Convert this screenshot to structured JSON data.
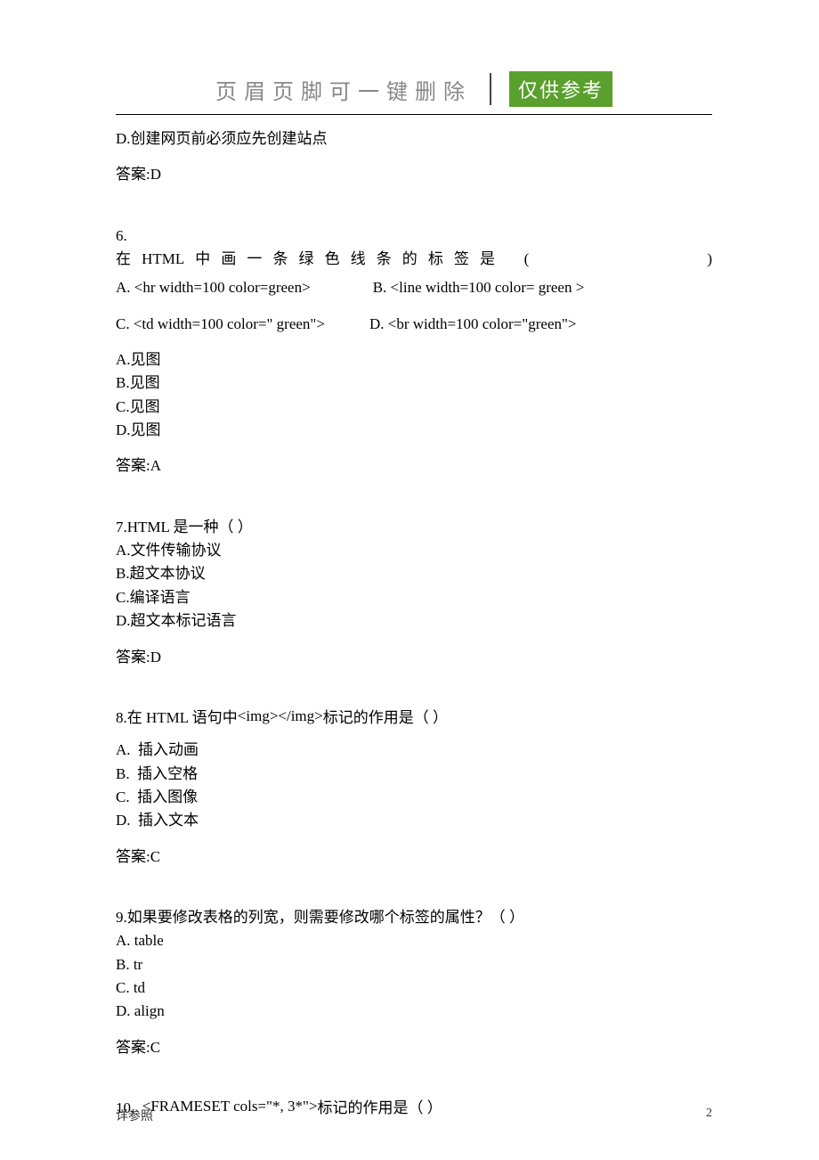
{
  "header": {
    "title": "页眉页脚可一键删除",
    "badge": "仅供参考"
  },
  "q5_tail": {
    "optD": "D.创建网页前必须应先创建站点",
    "answer": "答案:D"
  },
  "q6": {
    "num": "6.",
    "stem_chars": [
      "在",
      "HTML",
      "中",
      "画",
      "一",
      "条",
      "绿",
      "色",
      "线",
      "条",
      "的",
      "标",
      "签",
      "是"
    ],
    "paren_open": "(",
    "paren_close": ")",
    "imgA": "A. <hr width=100 color=green>",
    "imgB": "B. <line width=100 color= green >",
    "imgC": "C. <td width=100 color=\" green\">",
    "imgD": "D. <br width=100 color=\"green\">",
    "optA": "A.见图",
    "optB": "B.见图",
    "optC": "C.见图",
    "optD": "D.见图",
    "answer": "答案:A"
  },
  "q7": {
    "stem": "7.HTML 是一种（   ）",
    "optA": "A.文件传输协议",
    "optB": "B.超文本协议",
    "optC": "C.编译语言",
    "optD": "D.超文本标记语言",
    "answer": "答案:D"
  },
  "q8": {
    "stem_pre": "8.在 HTML 语句中",
    "img_tag": "<img></img>",
    "stem_post": "标记的作用是（          ）",
    "optA": "A.  插入动画",
    "optB": "B.  插入空格",
    "optC": "C.  插入图像",
    "optD": "D.  插入文本",
    "answer": "答案:C"
  },
  "q9": {
    "stem": "9.如果要修改表格的列宽，则需要修改哪个标签的属性？（      ）",
    "optA": "A. table",
    "optB": "B. tr",
    "optC": "C. td",
    "optD": "D. align",
    "answer": "答案:C"
  },
  "q10": {
    "num": "10.  ",
    "img_tag": "<FRAMESET cols=\"*, 3*\">",
    "stem_post": "标记的作用是（          ）"
  },
  "footer": {
    "left": "详参照",
    "right": "2"
  }
}
